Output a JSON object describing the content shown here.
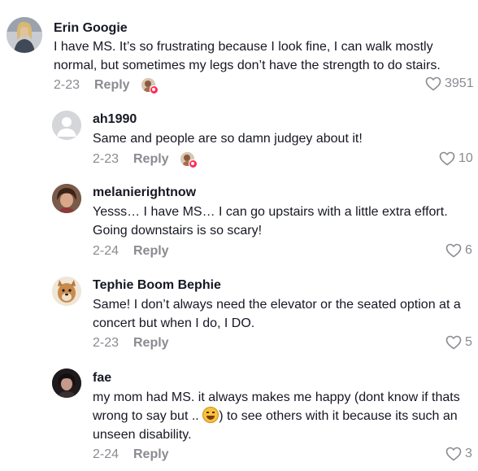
{
  "comments": [
    {
      "username": "Erin Googie",
      "text": "I have MS. It’s so frustrating because I look fine, I can walk mostly normal, but sometimes my legs don’t have the strength to do stairs.",
      "date": "2-23",
      "reply_label": "Reply",
      "likes": "3951",
      "creator_liked": true
    },
    {
      "username": "ah1990",
      "text": "Same and people are so damn judgey about it!",
      "date": "2-23",
      "reply_label": "Reply",
      "likes": "10",
      "creator_liked": true
    },
    {
      "username": "melanierightnow",
      "text": "Yesss… I have MS… I can go upstairs with a little extra effort. Going downstairs is so scary!",
      "date": "2-24",
      "reply_label": "Reply",
      "likes": "6",
      "creator_liked": false
    },
    {
      "username": "Tephie Boom Bephie",
      "text": "Same! I don’t always need the elevator or the seated option at a concert but when I do, I DO.",
      "date": "2-23",
      "reply_label": "Reply",
      "likes": "5",
      "creator_liked": false
    },
    {
      "username": "fae",
      "text_before_emoji": "my mom had MS. it always makes me happy (dont know if thats wrong to say but .. ",
      "emoji_name": "grinning-sweat-emoji",
      "text_after_emoji": ") to see others with it because its such an unseen disability.",
      "date": "2-24",
      "reply_label": "Reply",
      "likes": "3",
      "creator_liked": false
    }
  ],
  "colors": {
    "text": "#161823",
    "muted": "#8a8b91",
    "heart_badge": "#fe2c55"
  }
}
